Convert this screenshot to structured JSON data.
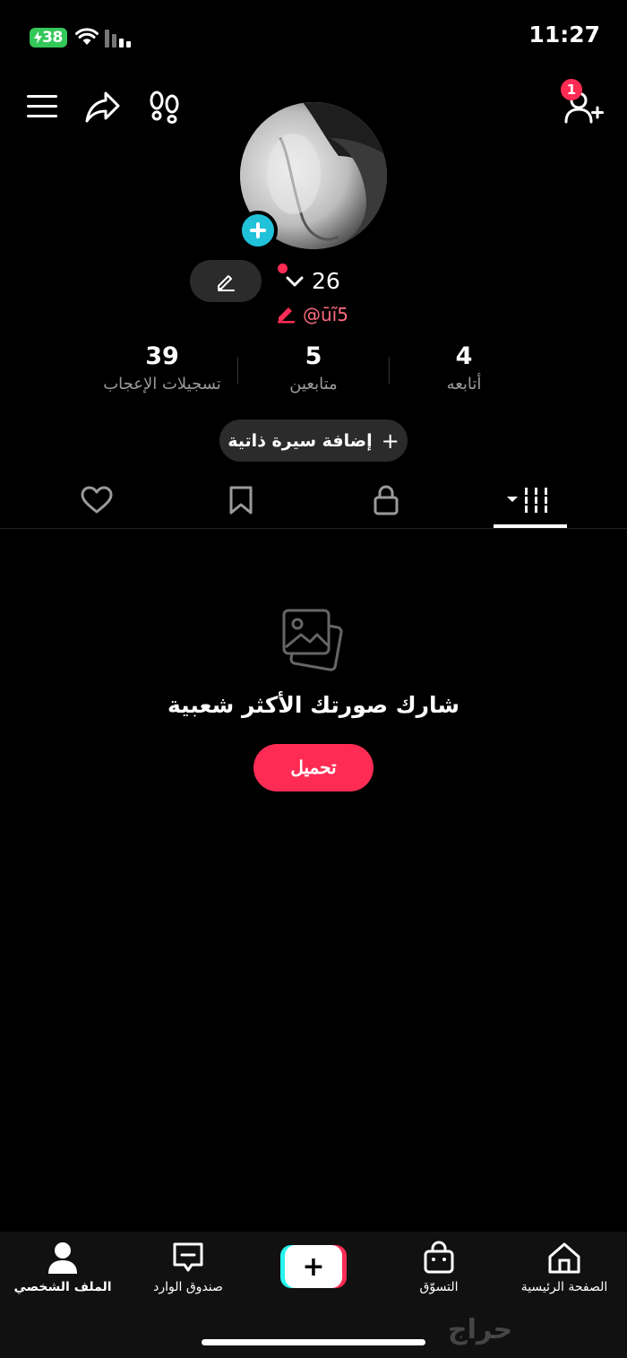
{
  "status_bar": {
    "battery": "38",
    "time": "11:27"
  },
  "header": {
    "notification_count": "1"
  },
  "profile": {
    "name": "26",
    "handle": "@ūĩ5"
  },
  "stats": {
    "likes": {
      "value": "39",
      "label": "تسجيلات الإعجاب"
    },
    "followers": {
      "value": "5",
      "label": "متابعين"
    },
    "following": {
      "value": "4",
      "label": "أتابعه"
    }
  },
  "bio_button": {
    "plus": "+",
    "label": "إضافة سيرة ذاتية"
  },
  "tabs": {
    "active": "videos"
  },
  "empty_state": {
    "title": "شارك صورتك الأكثر شعبية",
    "button": "تحميل"
  },
  "bottom_nav": {
    "home": "الصفحة الرئيسية",
    "shop": "التسوّق",
    "create": "+",
    "inbox": "صندوق الوارد",
    "profile": "الملف الشخصي"
  },
  "watermark": "حراج",
  "colors": {
    "accent": "#fe2c55",
    "cyan": "#1fc2d9",
    "battery": "#34c759"
  }
}
